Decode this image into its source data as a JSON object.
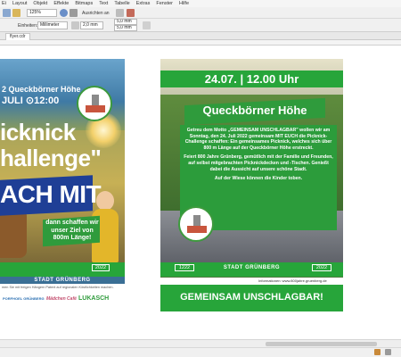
{
  "menu": {
    "items": [
      "Ei",
      "Layout",
      "Objekt",
      "Effekte",
      "Bitmaps",
      "Text",
      "Tabelle",
      "Extras",
      "Fenster",
      "Hilfe"
    ]
  },
  "toolbar1": {
    "zoom_value": "125%",
    "align_label": "Ausrichten an"
  },
  "toolbar2": {
    "units_label": "Einheiten:",
    "units_value": "Millimeter",
    "nudge_value": "2,0 mm",
    "dup_x": "5,0 mm",
    "dup_y": "5,0 mm"
  },
  "document": {
    "tab_label": "flyer.cdr"
  },
  "poster_left": {
    "date_line": "2 Queckbörner Höhe",
    "time_line": "JULI ⊙12:00",
    "title_line1": "icknick",
    "title_line2": "hallenge\"",
    "banner_text": "ACH MIT",
    "challenge_text": "dann schaffen wir unser Ziel von 800m Länge!",
    "year": "2022",
    "city": "STADT GRÜNBERG",
    "note": "men Sie mit freigen Hängern Patent auf regionalen Köstlichkeiten machen.",
    "sponsors": [
      "PORFHOEL GRÜNBERG",
      "Mädchen Café",
      "LUKASCH"
    ]
  },
  "poster_right": {
    "date_banner": "24.07. | 12.00 Uhr",
    "title": "Queckbörner Höhe",
    "body_paragraph1": "Getreu dem Motto „GEMEINSAM UNSCHLAGBAR\" wollen wir am Sonntag, den 24. Juli 2022 gemeinsam MIT EUCH die Picknick-Challenge schaffen: Ein gemeinsames Picknick, welches sich über 800 m Länge auf der Queckbörner Höhe erstreckt.",
    "body_paragraph2": "Feiert 800 Jahre Grünberg, gemütlich mit der Familie und Freunden, auf selbst mitgebrachten Picknickdecken und -Tischen. Genießt dabei die Aussicht auf unsere schöne Stadt.",
    "body_paragraph3": "Auf der Wiese können die Kinder toben.",
    "year_left": "1222",
    "year_right": "2022",
    "city": "STADT GRÜNBERG",
    "info": "Informationen: www.800jahre.gruenberg.de",
    "slogan": "GEMEINSAM UNSCHLAGBAR!"
  },
  "colors": {
    "green": "#27a53a",
    "blue": "#1f3f96"
  }
}
